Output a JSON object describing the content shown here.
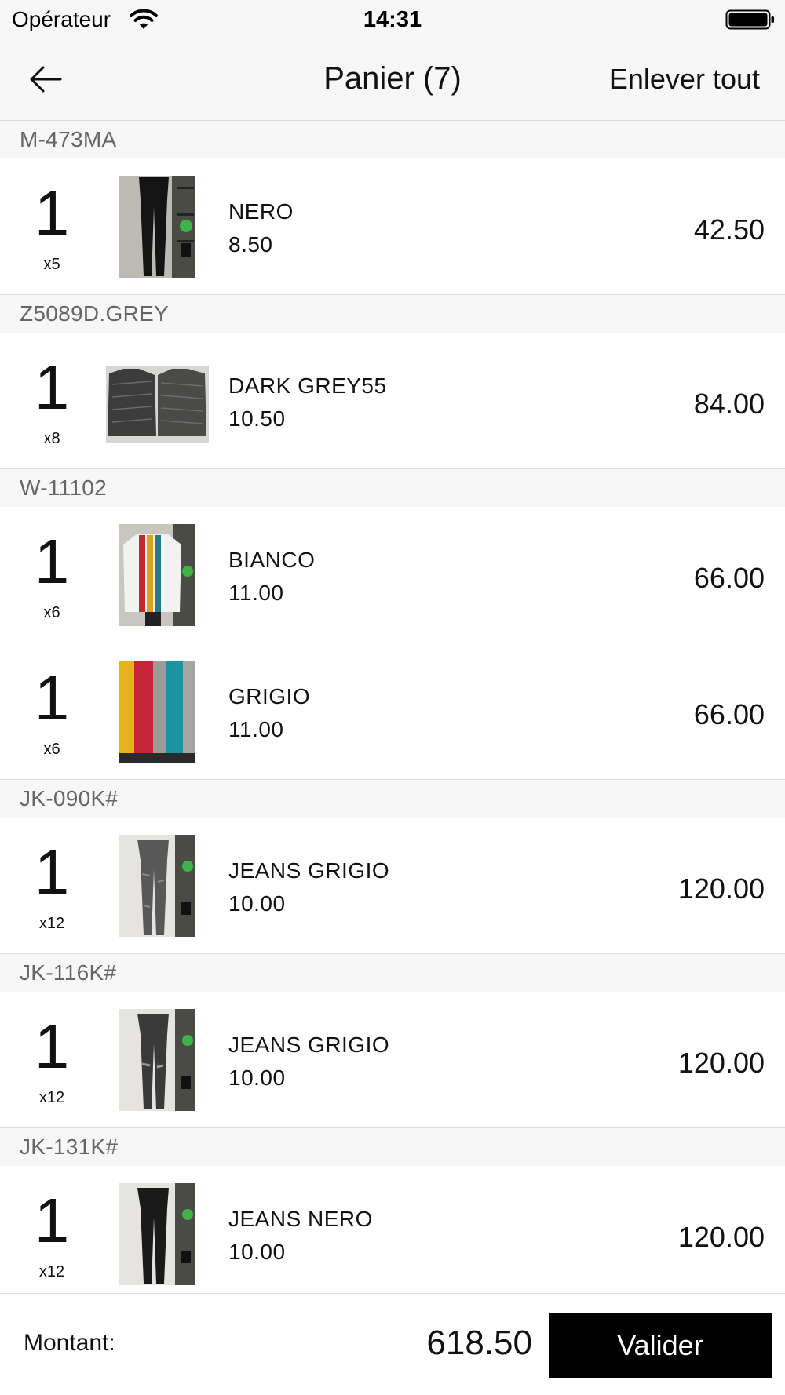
{
  "status_bar": {
    "carrier": "Opérateur",
    "time": "14:31",
    "wifi_icon": "wifi-icon",
    "battery_icon": "battery-icon"
  },
  "nav": {
    "back_icon": "arrow-left-icon",
    "title": "Panier (7)",
    "clear_all_label": "Enlever tout"
  },
  "groups": [
    {
      "code": "M-473MA",
      "items": [
        {
          "qty": "1",
          "pack": "x5",
          "name": "NERO",
          "unit_price": "8.50",
          "total": "42.50",
          "image": "black-pants-thumbnail"
        }
      ]
    },
    {
      "code": "Z5089D.GREY",
      "items": [
        {
          "qty": "1",
          "pack": "x8",
          "name": "DARK GREY55",
          "unit_price": "10.50",
          "total": "84.00",
          "image": "grey-knit-sweater-thumbnail"
        }
      ]
    },
    {
      "code": "W-11102",
      "items": [
        {
          "qty": "1",
          "pack": "x6",
          "name": "BIANCO",
          "unit_price": "11.00",
          "total": "66.00",
          "image": "white-striped-sweater-thumbnail"
        },
        {
          "qty": "1",
          "pack": "x6",
          "name": "GRIGIO",
          "unit_price": "11.00",
          "total": "66.00",
          "image": "grey-striped-sweater-thumbnail"
        }
      ]
    },
    {
      "code": "JK-090K#",
      "items": [
        {
          "qty": "1",
          "pack": "x12",
          "name": "JEANS GRIGIO",
          "unit_price": "10.00",
          "total": "120.00",
          "image": "grey-jeans-thumbnail"
        }
      ]
    },
    {
      "code": "JK-116K#",
      "items": [
        {
          "qty": "1",
          "pack": "x12",
          "name": "JEANS GRIGIO",
          "unit_price": "10.00",
          "total": "120.00",
          "image": "grey-ripped-jeans-thumbnail"
        }
      ]
    },
    {
      "code": "JK-131K#",
      "items": [
        {
          "qty": "1",
          "pack": "x12",
          "name": "JEANS NERO",
          "unit_price": "10.00",
          "total": "120.00",
          "image": "black-jeans-thumbnail"
        }
      ]
    }
  ],
  "footer": {
    "amount_label": "Montant:",
    "amount_value": "618.50",
    "validate_label": "Valider"
  },
  "colors": {
    "background": "#ffffff",
    "header_background": "#f7f7f7",
    "group_text": "#666666",
    "button_background": "#000000",
    "button_text": "#ffffff"
  }
}
